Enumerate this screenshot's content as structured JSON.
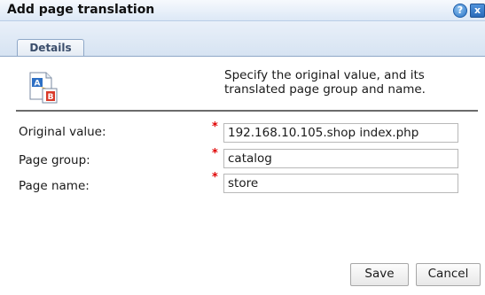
{
  "dialog": {
    "title": "Add page translation",
    "help_glyph": "?",
    "close_glyph": "x",
    "icon": "translate-document-icon"
  },
  "tabs": [
    {
      "label": "Details",
      "selected": true
    }
  ],
  "instructions": {
    "line1": "Specify the original value, and its",
    "line2": "translated page group and name."
  },
  "fields": {
    "original_value": {
      "label": "Original value:",
      "value": "192.168.10.105.shop index.php",
      "required": true
    },
    "page_group": {
      "label": "Page group:",
      "value": "catalog",
      "required": true
    },
    "page_name": {
      "label": "Page name:",
      "value": "store",
      "required": true
    }
  },
  "required_marker": "*",
  "buttons": {
    "save": "Save",
    "cancel": "Cancel"
  },
  "colors": {
    "required": "#e00000",
    "titlebar": "#dce8f6",
    "accent": "#2a74c7"
  }
}
